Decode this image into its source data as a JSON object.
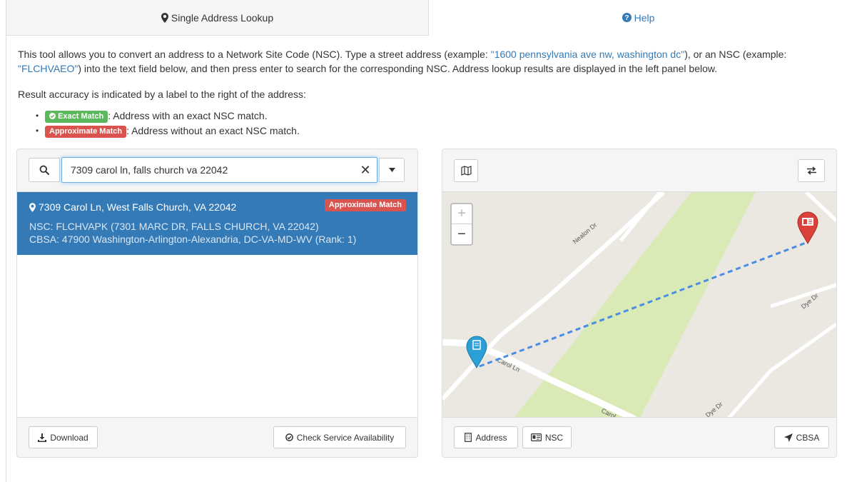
{
  "tabs": {
    "lookup": "Single Address Lookup",
    "help": "Help"
  },
  "intro": {
    "p1_before": "This tool allows you to convert an address to a Network Site Code (NSC). Type a street address (example: ",
    "example_address": "\"1600 pennsylvania ave nw, washington dc\"",
    "p1_middle": "), or an NSC (example: ",
    "example_nsc": "\"FLCHVAEO\"",
    "p1_after": ") into the text field below, and then press enter to search for the corresponding NSC. Address lookup results are displayed in the left panel below.",
    "accuracy": "Result accuracy is indicated by a label to the right of the address:",
    "legend": [
      {
        "label": "Exact Match",
        "text": ": Address with an exact NSC match."
      },
      {
        "label": "Approximate Match",
        "text": ": Address without an exact NSC match."
      }
    ]
  },
  "search": {
    "value": "7309 carol ln, falls church va 22042"
  },
  "result": {
    "address": "7309 Carol Ln, West Falls Church, VA 22042",
    "badge": "Approximate Match",
    "nsc": "NSC: FLCHVAPK (7301 MARC DR, FALLS CHURCH, VA 22042)",
    "cbsa": "CBSA: 47900 Washington-Arlington-Alexandria, DC-VA-MD-WV (Rank: 1)"
  },
  "left_footer": {
    "download": "Download",
    "check": "Check Service Availability"
  },
  "map": {
    "zoom_in": "+",
    "zoom_out": "−",
    "streets": [
      "Nealon Dr",
      "Dye Dr",
      "Carol Ln",
      "Carol",
      "Dye Dr"
    ]
  },
  "right_footer": {
    "address": "Address",
    "nsc": "NSC",
    "cbsa": "CBSA"
  },
  "colors": {
    "primary": "#337ab7",
    "success": "#5cb85c",
    "danger": "#d9534f",
    "park": "#d9eab6",
    "route": "#4a8de6"
  }
}
